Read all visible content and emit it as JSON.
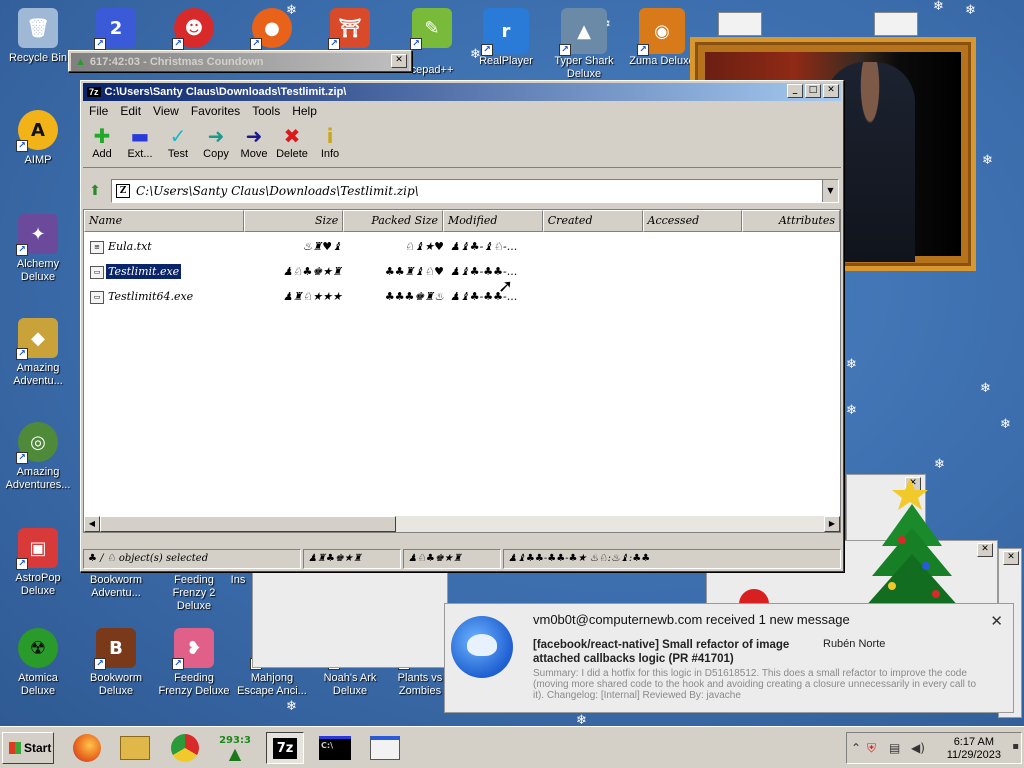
{
  "desktop_icons": [
    {
      "label": "Recycle Bin",
      "icon": "recycle-bin-icon",
      "color": "#9fb8d6"
    },
    {
      "label": "AIMP",
      "icon": "aimp-icon",
      "color": "#f2b318"
    },
    {
      "label": "Alchemy Deluxe",
      "icon": "wizard-icon",
      "color": "#6b4a9c"
    },
    {
      "label": "Amazing Adventu...",
      "icon": "gem-icon",
      "color": "#c9a23a"
    },
    {
      "label": "Amazing Adventures...",
      "icon": "globe-icon",
      "color": "#4f8a3a"
    },
    {
      "label": "AstroPop Deluxe",
      "icon": "astropop-icon",
      "color": "#d83a3a"
    },
    {
      "label": "Atomica Deluxe",
      "icon": "radiation-icon",
      "color": "#2a9a2a"
    },
    {
      "label": "Bookworm Adventu...",
      "icon": "bookworm-icon",
      "color": "#8a5a2a"
    },
    {
      "label": "Bookworm Deluxe",
      "icon": "book-icon",
      "color": "#7a3a1a"
    },
    {
      "label": "Feeding Frenzy 2 Deluxe",
      "icon": "fish-icon",
      "color": "#e08a2a"
    },
    {
      "label": "Feeding Frenzy Deluxe",
      "icon": "fish-pink-icon",
      "color": "#e0608a"
    },
    {
      "label": "Ins",
      "icon": "generic-icon",
      "color": "#aaaaaa"
    },
    {
      "label": "Mahjong Escape Anci...",
      "icon": "mahjong-icon",
      "color": "#c07a1a"
    },
    {
      "label": "Noah's Ark Deluxe",
      "icon": "ark-icon",
      "color": "#6a8a3a"
    },
    {
      "label": "Plants vs Zombies",
      "icon": "plant-icon",
      "color": "#5aa03a"
    },
    {
      "label": "",
      "icon": "app-2-icon",
      "color": "#3a5ad8"
    },
    {
      "label": "",
      "icon": "elmo-icon",
      "color": "#d82a2a"
    },
    {
      "label": "",
      "icon": "firefox-icon",
      "color": "#e8621a"
    },
    {
      "label": "",
      "icon": "torii-icon",
      "color": "#d84a2a"
    },
    {
      "label": "cepad++",
      "icon": "notepad-icon",
      "color": "#7aba3a"
    },
    {
      "label": "RealPlayer",
      "icon": "realplayer-icon",
      "color": "#2a7ad8"
    },
    {
      "label": "Typer Shark Deluxe",
      "icon": "shark-icon",
      "color": "#6a8aa8"
    },
    {
      "label": "Zuma Deluxe",
      "icon": "zuma-icon",
      "color": "#d87a1a"
    }
  ],
  "countdown_window": {
    "title": "617:42:03 - Christmas Coundown",
    "close": "✕"
  },
  "zip_window": {
    "title": "C:\\Users\\Santy Claus\\Downloads\\Testlimit.zip\\",
    "app_icon": "7z",
    "menu": [
      "File",
      "Edit",
      "View",
      "Favorites",
      "Tools",
      "Help"
    ],
    "toolbar": [
      {
        "label": "Add",
        "glyph": "✚",
        "color": "#1faa2a",
        "icon": "add-icon"
      },
      {
        "label": "Ext...",
        "glyph": "▬",
        "color": "#2a3ad8",
        "icon": "extract-icon"
      },
      {
        "label": "Test",
        "glyph": "✓",
        "color": "#1ab8c8",
        "icon": "test-icon"
      },
      {
        "label": "Copy",
        "glyph": "➜",
        "color": "#1a9a8a",
        "icon": "copy-icon"
      },
      {
        "label": "Move",
        "glyph": "➜",
        "color": "#1a1a8a",
        "icon": "move-icon"
      },
      {
        "label": "Delete",
        "glyph": "✖",
        "color": "#d81a1a",
        "icon": "delete-icon"
      },
      {
        "label": "Info",
        "glyph": "i",
        "color": "#c8a81a",
        "icon": "info-icon"
      }
    ],
    "address": "C:\\Users\\Santy Claus\\Downloads\\Testlimit.zip\\",
    "columns": [
      "Name",
      "Size",
      "Packed Size",
      "Modified",
      "Created",
      "Accessed",
      "Attributes"
    ],
    "files": [
      {
        "name": "Eula.txt",
        "size": "♨♜♥♝",
        "packed": "♘♝★♥",
        "modified": "♟♝♣-♝♘-...",
        "icon": "text-file-icon",
        "selected": false
      },
      {
        "name": "Testlimit.exe",
        "size": "♟♘♣♚★♜",
        "packed": "♣♣♜♝♘♥",
        "modified": "♟♝♣-♣♣-...",
        "icon": "exe-file-icon",
        "selected": true
      },
      {
        "name": "Testlimit64.exe",
        "size": "♟♜♘★★★",
        "packed": "♣♣♣♚♜♨",
        "modified": "♟♝♣-♣♣-...",
        "icon": "exe-file-icon",
        "selected": false
      }
    ],
    "status": [
      "♣ / ♘ object(s) selected",
      "♟♜♣♚★♜",
      "♟♘♣♚★♜",
      "♟♝♣♣-♣♣-♣★ ♨♘:♨♝:♣♣"
    ]
  },
  "notification": {
    "title": "vm0b0t@computernewb.com received 1 new message",
    "subject": "[facebook/react-native] Small refactor of image attached callbacks logic (PR #41701)",
    "author": "Rubén Norte",
    "body": "Summary: I did a hotfix for this logic in D51618512. This does a small refactor to improve the code (moving more shared code to the hook and avoiding creating a closure unnecessarily in every call to it). Changelog: [Internal] Reviewed By: javache",
    "close": "✕"
  },
  "taskbar": {
    "start": "Start",
    "apps": [
      {
        "name": "firefox",
        "label": "",
        "color": "#e8621a"
      },
      {
        "name": "file-explorer",
        "label": "",
        "color": "#e0b84a"
      },
      {
        "name": "chrome",
        "label": "",
        "color": "#2a9a3a"
      },
      {
        "name": "christmas-countdown",
        "label": "293:3",
        "color": "#1a8a1a"
      },
      {
        "name": "7zip",
        "label": "7z",
        "color": "#000000"
      },
      {
        "name": "command-prompt",
        "label": "C:\\",
        "color": "#000000"
      },
      {
        "name": "thunderbird",
        "label": "",
        "color": "#2a5ad8"
      }
    ],
    "time": "6:17 AM",
    "date": "11/29/2023"
  }
}
